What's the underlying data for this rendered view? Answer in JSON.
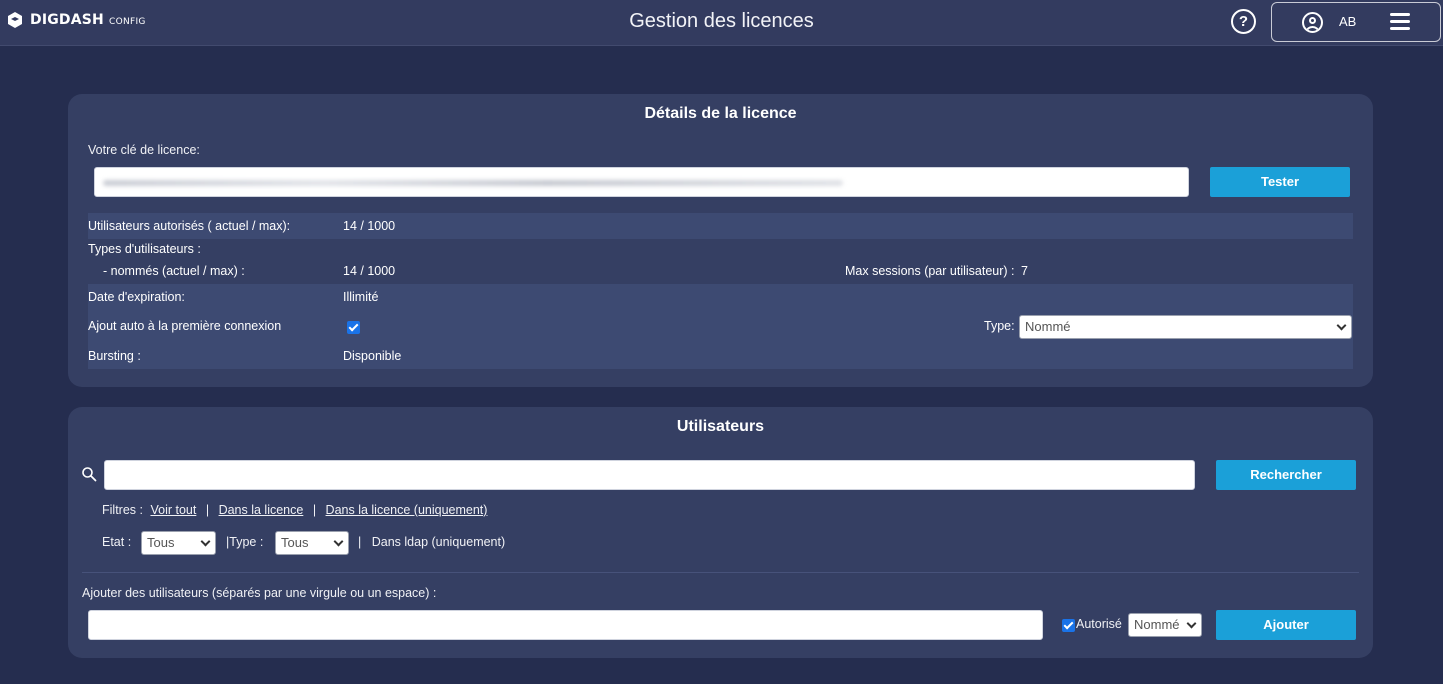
{
  "header": {
    "brand": "DIGDASH",
    "brand_sub": "CONFIG",
    "title": "Gestion des licences",
    "help": "?",
    "user_initials": "AB"
  },
  "license": {
    "title": "Détails de la licence",
    "key_label": "Votre clé de licence:",
    "test_button": "Tester",
    "authorized_users_label": "Utilisateurs autorisés ( actuel / max):",
    "authorized_users_value": "14 / 1000",
    "user_types_label": "Types d'utilisateurs :",
    "named_label": "- nommés (actuel / max) :",
    "named_value": "14 / 1000",
    "max_sessions_label": "Max sessions (par utilisateur) :",
    "max_sessions_value": "7",
    "expiration_label": "Date d'expiration:",
    "expiration_value": "Illimité",
    "auto_add_label": "Ajout auto à la première connexion",
    "auto_add_checked": true,
    "type_label": "Type:",
    "type_value": "Nommé",
    "bursting_label": "Bursting :",
    "bursting_value": "Disponible"
  },
  "users": {
    "title": "Utilisateurs",
    "search_placeholder": "",
    "search_button": "Rechercher",
    "filters_label": "Filtres :",
    "filter_all": "Voir tout",
    "filter_in_license": "Dans la licence",
    "filter_in_license_only": "Dans la licence (uniquement)",
    "separator": "|",
    "state_label": "Etat :",
    "state_value": "Tous",
    "type_label": "|Type :",
    "type_value": "Tous",
    "ldap_label": "Dans ldap (uniquement)",
    "add_label": "Ajouter des utilisateurs (séparés par une virgule ou un espace) :",
    "add_placeholder": "",
    "authorized_label": "Autorisé",
    "authorized_checked": true,
    "add_type_value": "Nommé",
    "add_button": "Ajouter"
  },
  "colors": {
    "background": "#252d4f",
    "card": "#353f63",
    "accent": "#1ba0d8"
  }
}
